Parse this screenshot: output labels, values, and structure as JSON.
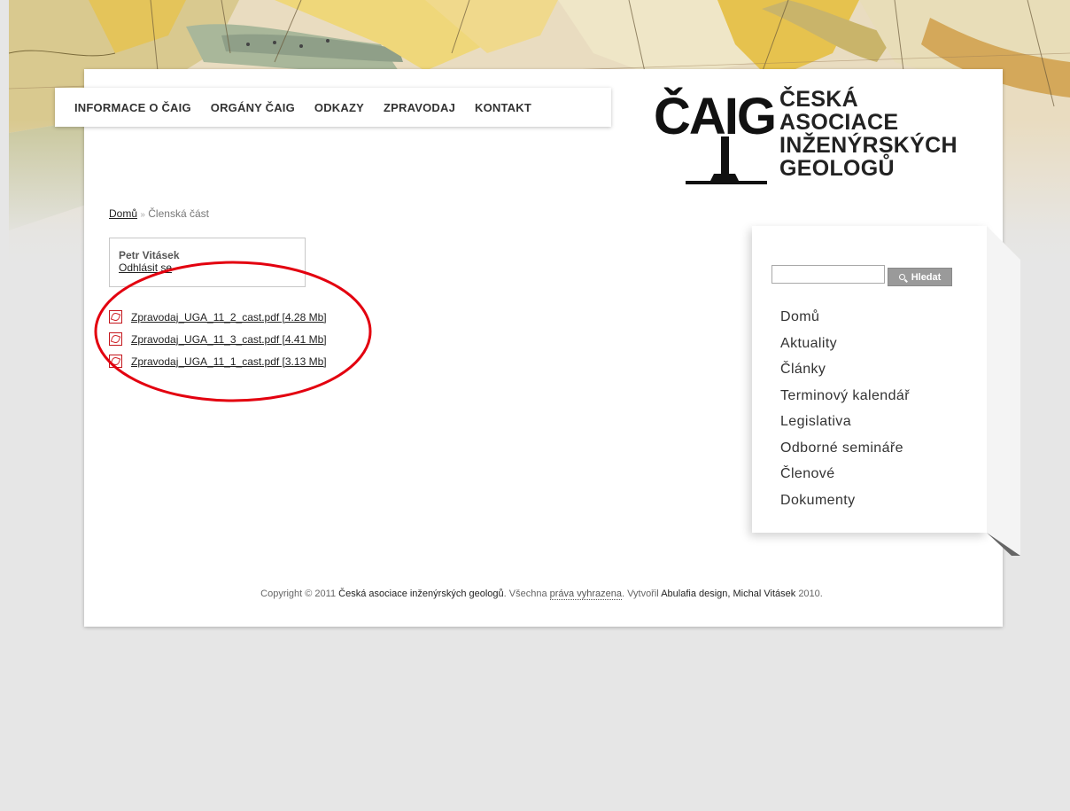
{
  "nav": {
    "items": [
      "INFORMACE O ČAIG",
      "ORGÁNY ČAIG",
      "ODKAZY",
      "ZPRAVODAJ",
      "KONTAKT"
    ]
  },
  "logo": {
    "mark": "ČAIG",
    "lines": [
      "ČESKÁ",
      "ASOCIACE",
      "INŽENÝRSKÝCH",
      "GEOLOGŮ"
    ]
  },
  "breadcrumb": {
    "home": "Domů",
    "separator": "»",
    "current": "Členská část"
  },
  "user": {
    "name": "Petr Vitásek",
    "logout": "Odhlásit se"
  },
  "files": [
    "Zpravodaj_UGA_11_2_cast.pdf [4.28 Mb]",
    "Zpravodaj_UGA_11_3_cast.pdf [4.41 Mb]",
    "Zpravodaj_UGA_11_1_cast.pdf [3.13 Mb]"
  ],
  "search": {
    "button": "Hledat",
    "value": ""
  },
  "sidebar": {
    "items": [
      "Domů",
      "Aktuality",
      "Články",
      "Terminový kalendář",
      "Legislativa",
      "Odborné semináře",
      "Členové",
      "Dokumenty"
    ]
  },
  "footer": {
    "prefix": "Copyright © 2011",
    "org": "Česká asociace inženýrských geologů",
    "rights_pre": ". Všechna",
    "rights_link": "práva vyhrazena",
    "made_by": ". Vytvořil",
    "designer": "Abulafia design, Michal Vitásek",
    "year": "2010."
  },
  "colors": {
    "annotation": "#e3000f",
    "pdf_red": "#c4161c",
    "page_bg": "#e6e6e6"
  }
}
